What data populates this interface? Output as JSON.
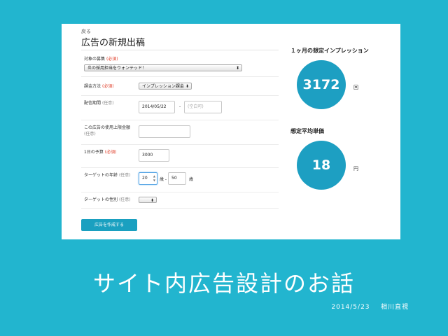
{
  "form": {
    "back_link": "戻る",
    "title": "広告の新規出稿",
    "required_tag": "(必須)",
    "optional_tag": "(任意)",
    "target_job": {
      "label": "対象の募集",
      "value": "炎の採用担当をウォンテッド！"
    },
    "billing": {
      "label": "課金方法",
      "value": "インプレッション課金"
    },
    "period": {
      "label": "配信期間",
      "start": "2014/05/22",
      "separator": "-",
      "end_placeholder": "(空白可)"
    },
    "budget_limit": {
      "label": "この広告の使用上限金額",
      "value": ""
    },
    "daily_budget": {
      "label": "1日の予算",
      "value": "3000"
    },
    "age": {
      "label": "ターゲットの年齢",
      "min": "20",
      "unit1": "歳 -",
      "max": "50",
      "unit2": "歳"
    },
    "gender": {
      "label": "ターゲットの性別",
      "value": ""
    },
    "submit_label": "広告を作成する"
  },
  "stats": {
    "impressions": {
      "heading": "１ヶ月の想定インプレッション",
      "value": "3172",
      "unit": "回"
    },
    "unit_price": {
      "heading": "想定平均単価",
      "value": "18",
      "unit": "円"
    }
  },
  "slide": {
    "title": "サイト内広告設計のお話",
    "date": "2014/5/23",
    "author": "相川直視"
  },
  "colors": {
    "background": "#22b5cf",
    "accent": "#1d9fc2",
    "required": "#e0402b"
  }
}
